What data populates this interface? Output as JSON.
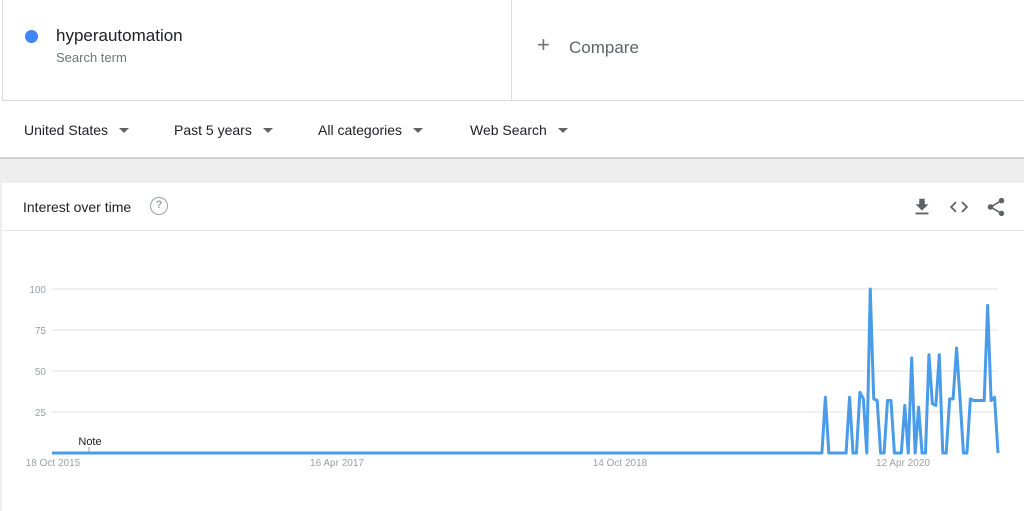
{
  "search_term": {
    "name": "hyperautomation",
    "subtitle": "Search term",
    "color": "#4285f4"
  },
  "compare": {
    "plus": "+",
    "label": "Compare"
  },
  "filters": [
    {
      "label": "United States"
    },
    {
      "label": "Past 5 years"
    },
    {
      "label": "All categories"
    },
    {
      "label": "Web Search"
    }
  ],
  "card": {
    "title": "Interest over time",
    "help_icon": "?",
    "actions": [
      "download-icon",
      "embed-code-icon",
      "share-icon"
    ]
  },
  "chart_data": {
    "type": "line",
    "ylim": [
      0,
      100
    ],
    "y_ticks": [
      "100",
      "75",
      "50",
      "25"
    ],
    "x_ticks": [
      "18 Oct 2015",
      "16 Apr 2017",
      "14 Oct 2018",
      "12 Apr 2020"
    ],
    "note_label": "Note",
    "grid": true,
    "series": [
      {
        "color": "#4a9be8",
        "values": [
          0,
          0,
          0,
          0,
          0,
          0,
          0,
          0,
          0,
          0,
          0,
          0,
          0,
          0,
          0,
          0,
          0,
          0,
          0,
          0,
          0,
          0,
          0,
          0,
          0,
          0,
          0,
          0,
          0,
          0,
          0,
          0,
          0,
          0,
          0,
          0,
          0,
          0,
          0,
          0,
          0,
          0,
          0,
          0,
          0,
          0,
          0,
          0,
          0,
          0,
          0,
          0,
          0,
          0,
          0,
          0,
          0,
          0,
          0,
          0,
          0,
          0,
          0,
          0,
          0,
          0,
          0,
          0,
          0,
          0,
          0,
          0,
          0,
          0,
          0,
          0,
          0,
          0,
          0,
          0,
          0,
          0,
          0,
          0,
          0,
          0,
          0,
          0,
          0,
          0,
          0,
          0,
          0,
          0,
          0,
          0,
          0,
          0,
          0,
          0,
          0,
          0,
          0,
          0,
          0,
          0,
          0,
          0,
          0,
          0,
          0,
          0,
          0,
          0,
          0,
          0,
          0,
          0,
          0,
          0,
          0,
          0,
          0,
          0,
          0,
          0,
          0,
          0,
          0,
          0,
          0,
          0,
          0,
          0,
          0,
          0,
          0,
          0,
          0,
          0,
          0,
          0,
          0,
          0,
          0,
          0,
          0,
          0,
          0,
          0,
          0,
          0,
          0,
          0,
          0,
          0,
          0,
          0,
          0,
          0,
          0,
          0,
          0,
          0,
          0,
          0,
          0,
          0,
          0,
          0,
          0,
          0,
          0,
          0,
          0,
          0,
          0,
          0,
          0,
          0,
          0,
          0,
          0,
          0,
          0,
          0,
          0,
          0,
          0,
          0,
          0,
          0,
          0,
          0,
          0,
          0,
          0,
          0,
          0,
          0,
          0,
          0,
          0,
          0,
          0,
          0,
          0,
          0,
          0,
          0,
          0,
          0,
          0,
          0,
          0,
          0,
          0,
          0,
          0,
          0,
          0,
          0,
          0,
          0,
          34,
          0,
          0,
          0,
          0,
          0,
          0,
          34,
          0,
          0,
          37,
          33,
          0,
          100,
          33,
          32,
          0,
          0,
          32,
          32,
          0,
          0,
          0,
          29,
          0,
          58,
          0,
          28,
          0,
          0,
          60,
          30,
          29,
          60,
          0,
          0,
          33,
          33,
          64,
          33,
          0,
          0,
          33,
          32,
          32,
          32,
          32,
          90,
          32,
          34,
          0
        ]
      }
    ]
  }
}
